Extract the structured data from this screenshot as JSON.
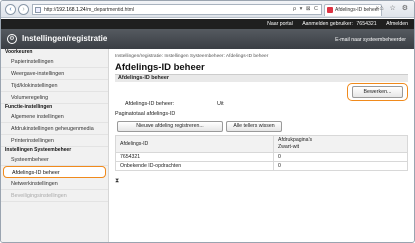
{
  "browser": {
    "url_prefix": "http://",
    "url_host": "192.168.1.24",
    "url_path": "/m_departmentid.html",
    "url_controls": "ρ ▾ ⊠ C",
    "tab_label": "Afdelings-ID beheer",
    "tab_close": "×",
    "top_icons": "⌂ ☆ ⚙",
    "back": "‹",
    "forward": "›"
  },
  "topbar": {
    "portal": "Naar portal",
    "logout": "Aanmelden gebruiker:",
    "user": "7654321",
    "signout": "Afmelden"
  },
  "header": {
    "title": "Instellingen/registratie",
    "logo": "⚙",
    "mail": "E-mail naar systeembeheerder"
  },
  "sidebar": {
    "sections": [
      {
        "heading": "Voorkeuren",
        "items": [
          "Papierinstellingen",
          "Weergave-instellingen",
          "Tijd/klokinstellingen",
          "Volumeregeling"
        ]
      },
      {
        "heading": "Functie-instellingen",
        "items": [
          "Algemene instellingen",
          "Afdrukinstellingen geheugenmedia",
          "Printerinstellingen"
        ]
      },
      {
        "heading": "Instellingen Systeembeheer",
        "items": [
          "Systeembeheer",
          "Afdelings-ID beheer",
          "Netwerkinstellingen",
          "Beveiligingsinstellingen"
        ]
      }
    ]
  },
  "main": {
    "breadcrumb": "Instellingen/registratie: Instellingen Systeembeheer: Afdelings-ID beheer",
    "title": "Afdelings-ID beheer",
    "section_title": "Afdelings-ID beheer",
    "edit_button": "Bewerken...",
    "status_label": "Afdelings-ID beheer:",
    "status_value": "Uit",
    "page_totals_title": "Paginatotaal afdelings-ID",
    "register_button": "Nieuwe afdeling registreren...",
    "clear_button": "Alle tellers wissen",
    "table": {
      "col1": "Afdelings-ID",
      "col2_line1": "Afdrukpagina's",
      "col2_line2": "Zwart-wit",
      "rows": [
        {
          "id": "7654321",
          "value": "0"
        },
        {
          "id": "Onbekende ID-opdrachten",
          "value": "0"
        }
      ]
    },
    "collapse_icon": "⧗"
  }
}
